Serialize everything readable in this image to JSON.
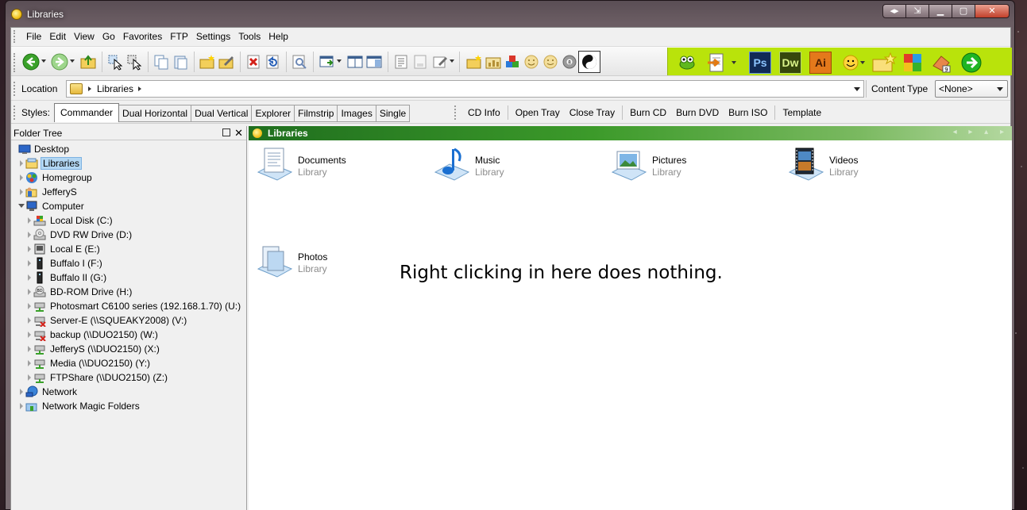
{
  "window": {
    "title": "Libraries"
  },
  "menu": [
    "File",
    "Edit",
    "View",
    "Go",
    "Favorites",
    "FTP",
    "Settings",
    "Tools",
    "Help"
  ],
  "location": {
    "label": "Location",
    "path": "Libraries"
  },
  "content_type": {
    "label": "Content Type",
    "value": "<None>"
  },
  "styles": {
    "label": "Styles:",
    "tabs": [
      "Commander",
      "Dual Horizontal",
      "Dual Vertical",
      "Explorer",
      "Filmstrip",
      "Images",
      "Single"
    ],
    "active": "Commander"
  },
  "burn_tools": [
    "CD Info",
    "Open Tray",
    "Close Tray",
    "Burn CD",
    "Burn DVD",
    "Burn ISO",
    "Template"
  ],
  "green_toolbar": {
    "app_labels": [
      "Ps",
      "Dw",
      "Ai"
    ]
  },
  "folder_tree": {
    "title": "Folder Tree",
    "items": [
      "Desktop",
      "Libraries",
      "Homegroup",
      "JefferyS",
      "Computer",
      "Local Disk (C:)",
      "DVD RW Drive (D:)",
      "Local E (E:)",
      "Buffalo I (F:)",
      "Buffalo II (G:)",
      "BD-ROM Drive (H:)",
      "Photosmart C6100 series (192.168.1.70) (U:)",
      "Server-E (\\\\SQUEAKY2008) (V:)",
      "backup (\\\\DUO2150) (W:)",
      "JefferyS (\\\\DUO2150) (X:)",
      "Media (\\\\DUO2150) (Y:)",
      "FTPShare (\\\\DUO2150) (Z:)",
      "Network",
      "Network Magic Folders"
    ]
  },
  "main_pane": {
    "title": "Libraries",
    "libraries": [
      {
        "name": "Documents",
        "type": "Library"
      },
      {
        "name": "Music",
        "type": "Library"
      },
      {
        "name": "Pictures",
        "type": "Library"
      },
      {
        "name": "Videos",
        "type": "Library"
      },
      {
        "name": "Photos",
        "type": "Library"
      }
    ],
    "annotation": "Right clicking in here does nothing."
  }
}
